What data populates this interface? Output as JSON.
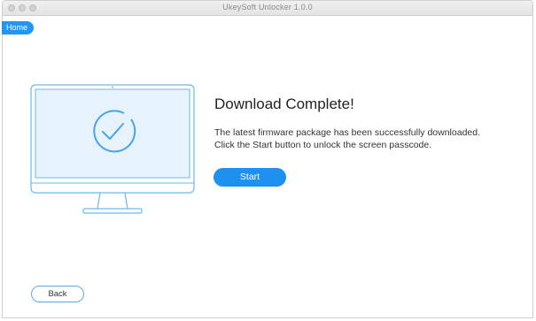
{
  "window": {
    "title": "UkeySoft Unlocker 1.0.0"
  },
  "nav": {
    "home_label": "Home"
  },
  "main": {
    "heading": "Download Complete!",
    "line1": "The latest firmware package has been successfully downloaded.",
    "line2": "Click the Start button to unlock the screen passcode.",
    "start_label": "Start"
  },
  "footer": {
    "back_label": "Back"
  },
  "icons": {
    "illustration": "monitor-checkmark-icon"
  },
  "colors": {
    "accent": "#1e90f0",
    "monitor_stroke": "#6bb8ee",
    "screen_fill": "#e6f3fd"
  }
}
